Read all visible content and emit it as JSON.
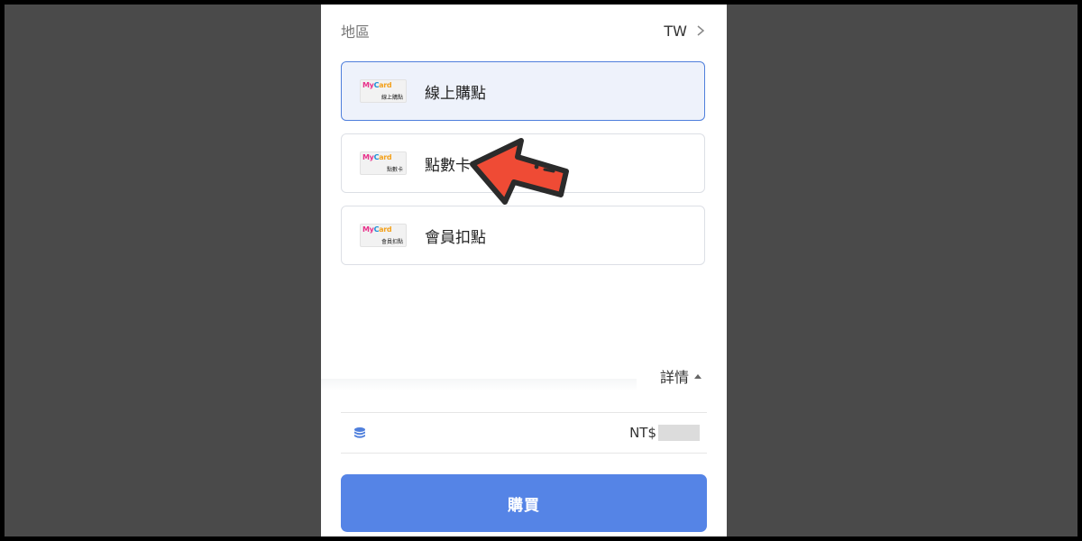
{
  "region": {
    "label": "地區",
    "value": "TW"
  },
  "payment_options": [
    {
      "label": "線上購點",
      "logo_brand": "MyCard",
      "logo_sub": "線上購點",
      "selected": true
    },
    {
      "label": "點數卡",
      "logo_brand": "MyCard",
      "logo_sub": "點數卡",
      "selected": false
    },
    {
      "label": "會員扣點",
      "logo_brand": "MyCard",
      "logo_sub": "會員扣點",
      "selected": false
    }
  ],
  "details": {
    "label": "詳情"
  },
  "price": {
    "currency": "NT$"
  },
  "buy_button": {
    "label": "購買"
  },
  "colors": {
    "accent": "#5584e6",
    "selected_bg": "#eef2fb",
    "arrow": "#ef4b35"
  },
  "icons": [
    "chevron-right-icon",
    "caret-up-icon",
    "coins-icon",
    "pointer-arrow-icon"
  ]
}
